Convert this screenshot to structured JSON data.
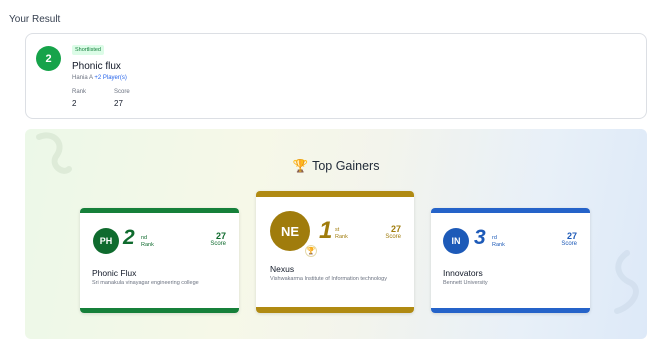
{
  "section_title": "Your Result",
  "result": {
    "rank_badge": "2",
    "status": "Shortlisted",
    "team_name": "Phonic flux",
    "member": "Hania A",
    "more_members": "+2 Player(s)",
    "rank_label": "Rank",
    "rank_value": "2",
    "score_label": "Score",
    "score_value": "27"
  },
  "gainers": {
    "title": "Top Gainers",
    "cards": [
      {
        "initials": "PH",
        "rank": "2",
        "suffix": "nd",
        "rank_label": "Rank",
        "score": "27",
        "score_label": "Score",
        "name": "Phonic Flux",
        "institution": "Sri manakula vinayagar engineering college",
        "color": "#0f6b2e"
      },
      {
        "initials": "NE",
        "rank": "1",
        "suffix": "st",
        "rank_label": "Rank",
        "score": "27",
        "score_label": "Score",
        "name": "Nexus",
        "institution": "Vishwakarma Institute of Information technology",
        "color": "#a07c0c"
      },
      {
        "initials": "IN",
        "rank": "3",
        "suffix": "rd",
        "rank_label": "Rank",
        "score": "27",
        "score_label": "Score",
        "name": "Innovators",
        "institution": "Bennett University",
        "color": "#1d5ab8"
      }
    ]
  }
}
